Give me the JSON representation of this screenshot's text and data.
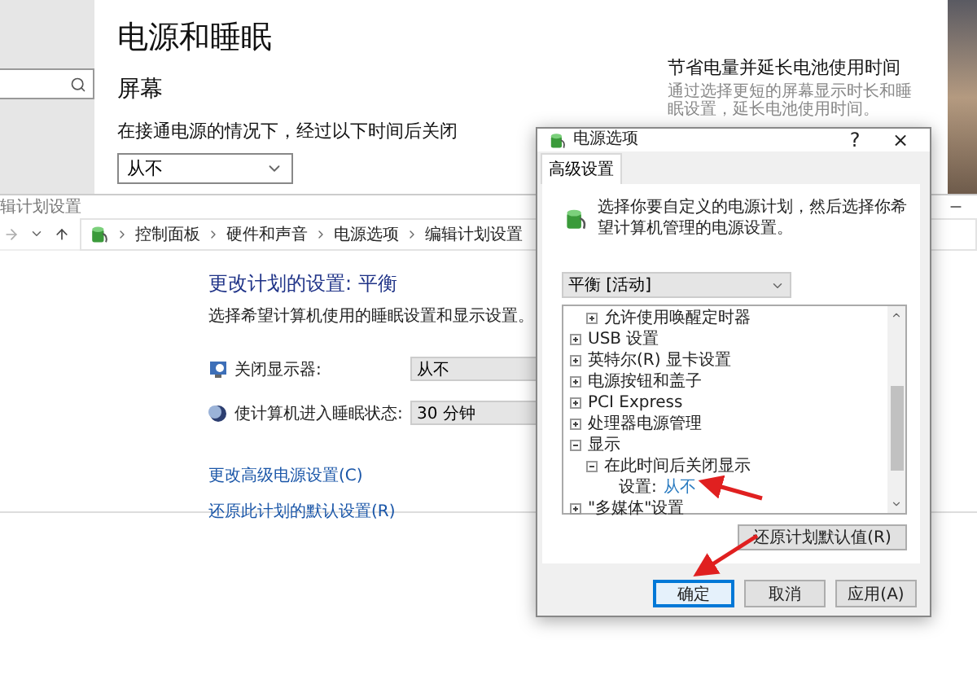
{
  "settings": {
    "title": "电源和睡眠",
    "section": "屏幕",
    "label": "在接通电源的情况下，经过以下时间后关闭",
    "dropdown": "从不",
    "side_title": "节省电量并延长电池使用时间",
    "side_text": "通过选择更短的屏幕显示时长和睡眠设置，延长电池使用时间。"
  },
  "control_panel": {
    "title": "辑计划设置",
    "breadcrumb": [
      "控制面板",
      "硬件和声音",
      "电源选项",
      "编辑计划设置"
    ],
    "heading": "更改计划的设置: 平衡",
    "subtitle": "选择希望计算机使用的睡眠设置和显示设置。",
    "rows": [
      {
        "kind": "monitor",
        "label": "关闭显示器:",
        "value": "从不"
      },
      {
        "kind": "sleep",
        "label": "使计算机进入睡眠状态:",
        "value": "30 分钟"
      }
    ],
    "links": [
      "更改高级电源设置(C)",
      "还原此计划的默认设置(R)"
    ]
  },
  "dialog": {
    "title": "电源选项",
    "help": "?",
    "close": "×",
    "tabs": [
      {
        "label": "高级设置",
        "selected": true
      }
    ],
    "description": "选择你要自定义的电源计划，然后选择你希望计算机管理的电源设置。",
    "plan": "平衡 [活动]",
    "tree": [
      {
        "children": [
          {
            "label": "允许使用唤醒定时器",
            "expanded": false
          }
        ]
      },
      {
        "label": "USB 设置",
        "expanded": false
      },
      {
        "label": "英特尔(R) 显卡设置",
        "expanded": false
      },
      {
        "label": "电源按钮和盖子",
        "expanded": false
      },
      {
        "label": "PCI Express",
        "expanded": false
      },
      {
        "label": "处理器电源管理",
        "expanded": false
      },
      {
        "label": "显示",
        "expanded": true,
        "children": [
          {
            "label": "在此时间后关闭显示",
            "expanded": true,
            "children": [
              {
                "label": "设置:",
                "value": "从不"
              }
            ]
          }
        ]
      },
      {
        "label": "\"多媒体\"设置",
        "expanded": false
      }
    ],
    "restore_button": "还原计划默认值(R)",
    "buttons": [
      {
        "label": "确定",
        "default": true
      },
      {
        "label": "取消",
        "default": false
      },
      {
        "label": "应用(A)",
        "default": false
      }
    ]
  }
}
